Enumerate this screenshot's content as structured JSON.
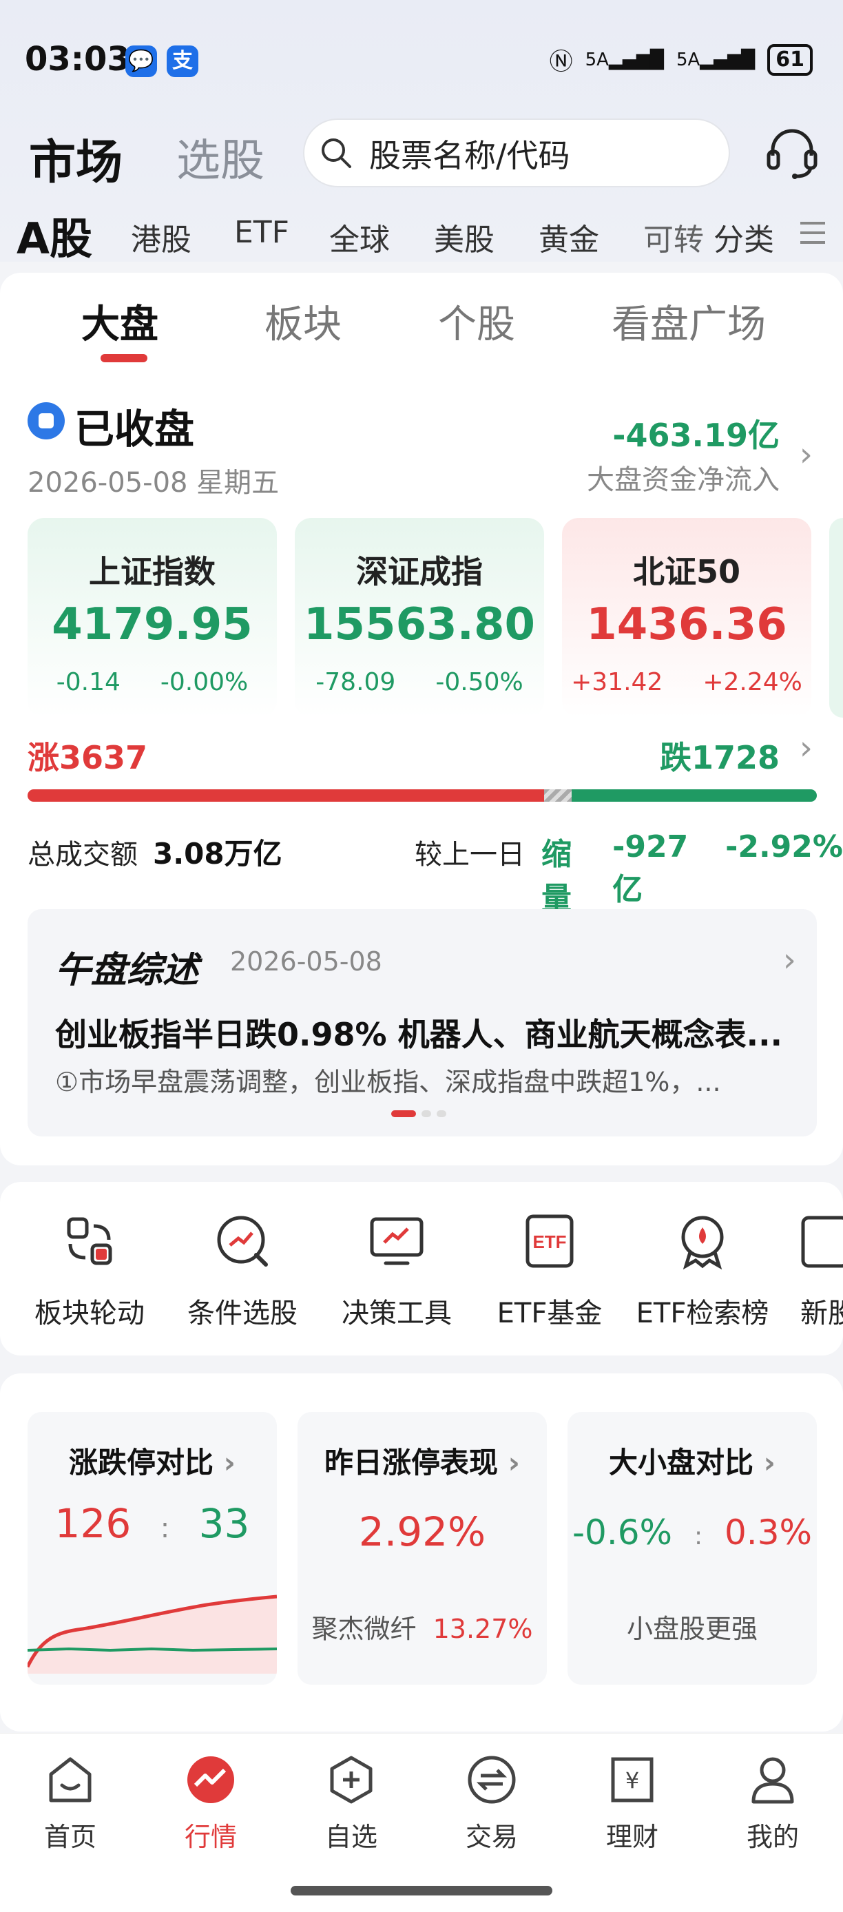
{
  "status_bar": {
    "time": "03:03",
    "notif1": "💬",
    "notif2": "支",
    "signal1": "5A",
    "signal2": "5A",
    "battery": "61"
  },
  "header": {
    "title": "市场",
    "tab2": "选股",
    "search_placeholder": "股票名称/代码"
  },
  "categories": [
    "A股",
    "港股",
    "ETF",
    "全球",
    "美股",
    "黄金",
    "可转",
    "分类"
  ],
  "subtabs": [
    "大盘",
    "板块",
    "个股",
    "看盘广场"
  ],
  "market_status": {
    "label": "已收盘",
    "date": "2026-05-08 星期五",
    "flow_value": "-463.19亿",
    "flow_label": "大盘资金净流入"
  },
  "indices": [
    {
      "name": "上证指数",
      "value": "4179.95",
      "change": "-0.14",
      "pct": "-0.00%",
      "trend": "down"
    },
    {
      "name": "深证成指",
      "value": "15563.80",
      "change": "-78.09",
      "pct": "-0.50%",
      "trend": "down"
    },
    {
      "name": "北证50",
      "value": "1436.36",
      "change": "+31.42",
      "pct": "+2.24%",
      "trend": "up"
    }
  ],
  "breadth": {
    "up_label": "涨3637",
    "down_label": "跌1728",
    "up_count": 3637,
    "down_count": 1728
  },
  "volume": {
    "label": "总成交额",
    "value": "3.08万亿",
    "compare_label": "较上一日",
    "compare_type": "缩量",
    "compare_value": "-927亿",
    "compare_pct": "-2.92%"
  },
  "news": {
    "brand": "午盘综述",
    "date": "2026-05-08",
    "title": "创业板指半日跌0.98% 机器人、商业航天概念表...",
    "summary": "①市场早盘震荡调整，创业板指、深成指盘中跌超1%，..."
  },
  "tools": [
    {
      "label": "板块轮动",
      "icon": "sector-rotation-icon"
    },
    {
      "label": "条件选股",
      "icon": "condition-select-icon"
    },
    {
      "label": "决策工具",
      "icon": "decision-tool-icon"
    },
    {
      "label": "ETF基金",
      "icon": "etf-fund-icon"
    },
    {
      "label": "ETF检索榜",
      "icon": "etf-rank-icon"
    },
    {
      "label": "新股",
      "icon": "new-stock-icon"
    }
  ],
  "stats": {
    "limit": {
      "title": "涨跌停对比",
      "up": "126",
      "sep": ":",
      "down": "33"
    },
    "yesterday": {
      "title": "昨日涨停表现",
      "value": "2.92%",
      "stock": "聚杰微纤",
      "stock_pct": "13.27%"
    },
    "size": {
      "title": "大小盘对比",
      "large": "-0.6%",
      "sep": ":",
      "small": "0.3%",
      "note": "小盘股更强"
    }
  },
  "bottom_nav": [
    {
      "label": "首页",
      "icon": "home-icon"
    },
    {
      "label": "行情",
      "icon": "market-icon",
      "active": true
    },
    {
      "label": "自选",
      "icon": "watchlist-icon"
    },
    {
      "label": "交易",
      "icon": "trade-icon"
    },
    {
      "label": "理财",
      "icon": "wealth-icon"
    },
    {
      "label": "我的",
      "icon": "profile-icon"
    }
  ],
  "colors": {
    "up": "#e03a3a",
    "down": "#1f9a63",
    "accent": "#e03a3a"
  }
}
